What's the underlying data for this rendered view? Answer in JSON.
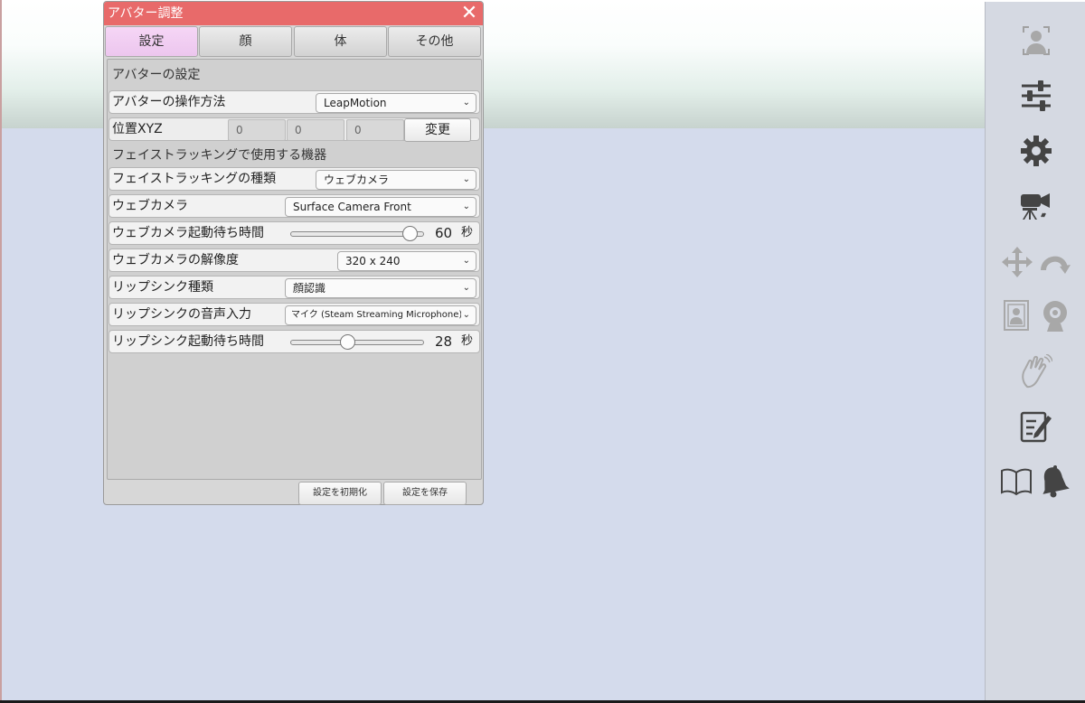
{
  "dialog": {
    "title": "アバター調整",
    "close_glyph": "✕",
    "tabs": [
      {
        "label": "設定",
        "active": true
      },
      {
        "label": "顔",
        "active": false
      },
      {
        "label": "体",
        "active": false
      },
      {
        "label": "その他",
        "active": false
      }
    ],
    "section_avatar": "アバターの設定",
    "control_method": {
      "label": "アバターの操作方法",
      "value": "LeapMotion"
    },
    "position": {
      "label": "位置XYZ",
      "x": "0",
      "y": "0",
      "z": "0",
      "button": "変更"
    },
    "section_face": "フェイストラッキングで使用する機器",
    "face_tracking_type": {
      "label": "フェイストラッキングの種類",
      "value": "ウェブカメラ"
    },
    "webcam": {
      "label": "ウェブカメラ",
      "value": "Surface Camera Front"
    },
    "webcam_wait": {
      "label": "ウェブカメラ起動待ち時間",
      "value": "60",
      "unit": "秒",
      "fraction": 0.95
    },
    "webcam_resolution": {
      "label": "ウェブカメラの解像度",
      "value": "320 x 240"
    },
    "lipsync_type": {
      "label": "リップシンク種類",
      "value": "顔認識"
    },
    "lipsync_audio": {
      "label": "リップシンクの音声入力",
      "value": "マイク (Steam Streaming Microphone)"
    },
    "lipsync_wait": {
      "label": "リップシンク起動待ち時間",
      "value": "28",
      "unit": "秒",
      "fraction": 0.42
    },
    "footer": {
      "reset": "設定を初期化",
      "save": "設定を保存"
    }
  },
  "toolbar": {
    "icons": [
      "avatar-frame-icon",
      "sliders-icon",
      "gear-icon",
      "camera-tripod-icon",
      "move-arrows-icon",
      "rotate-icon",
      "portrait-icon",
      "webcam-icon",
      "hand-wave-icon",
      "notepad-icon",
      "book-icon",
      "bell-icon"
    ]
  }
}
